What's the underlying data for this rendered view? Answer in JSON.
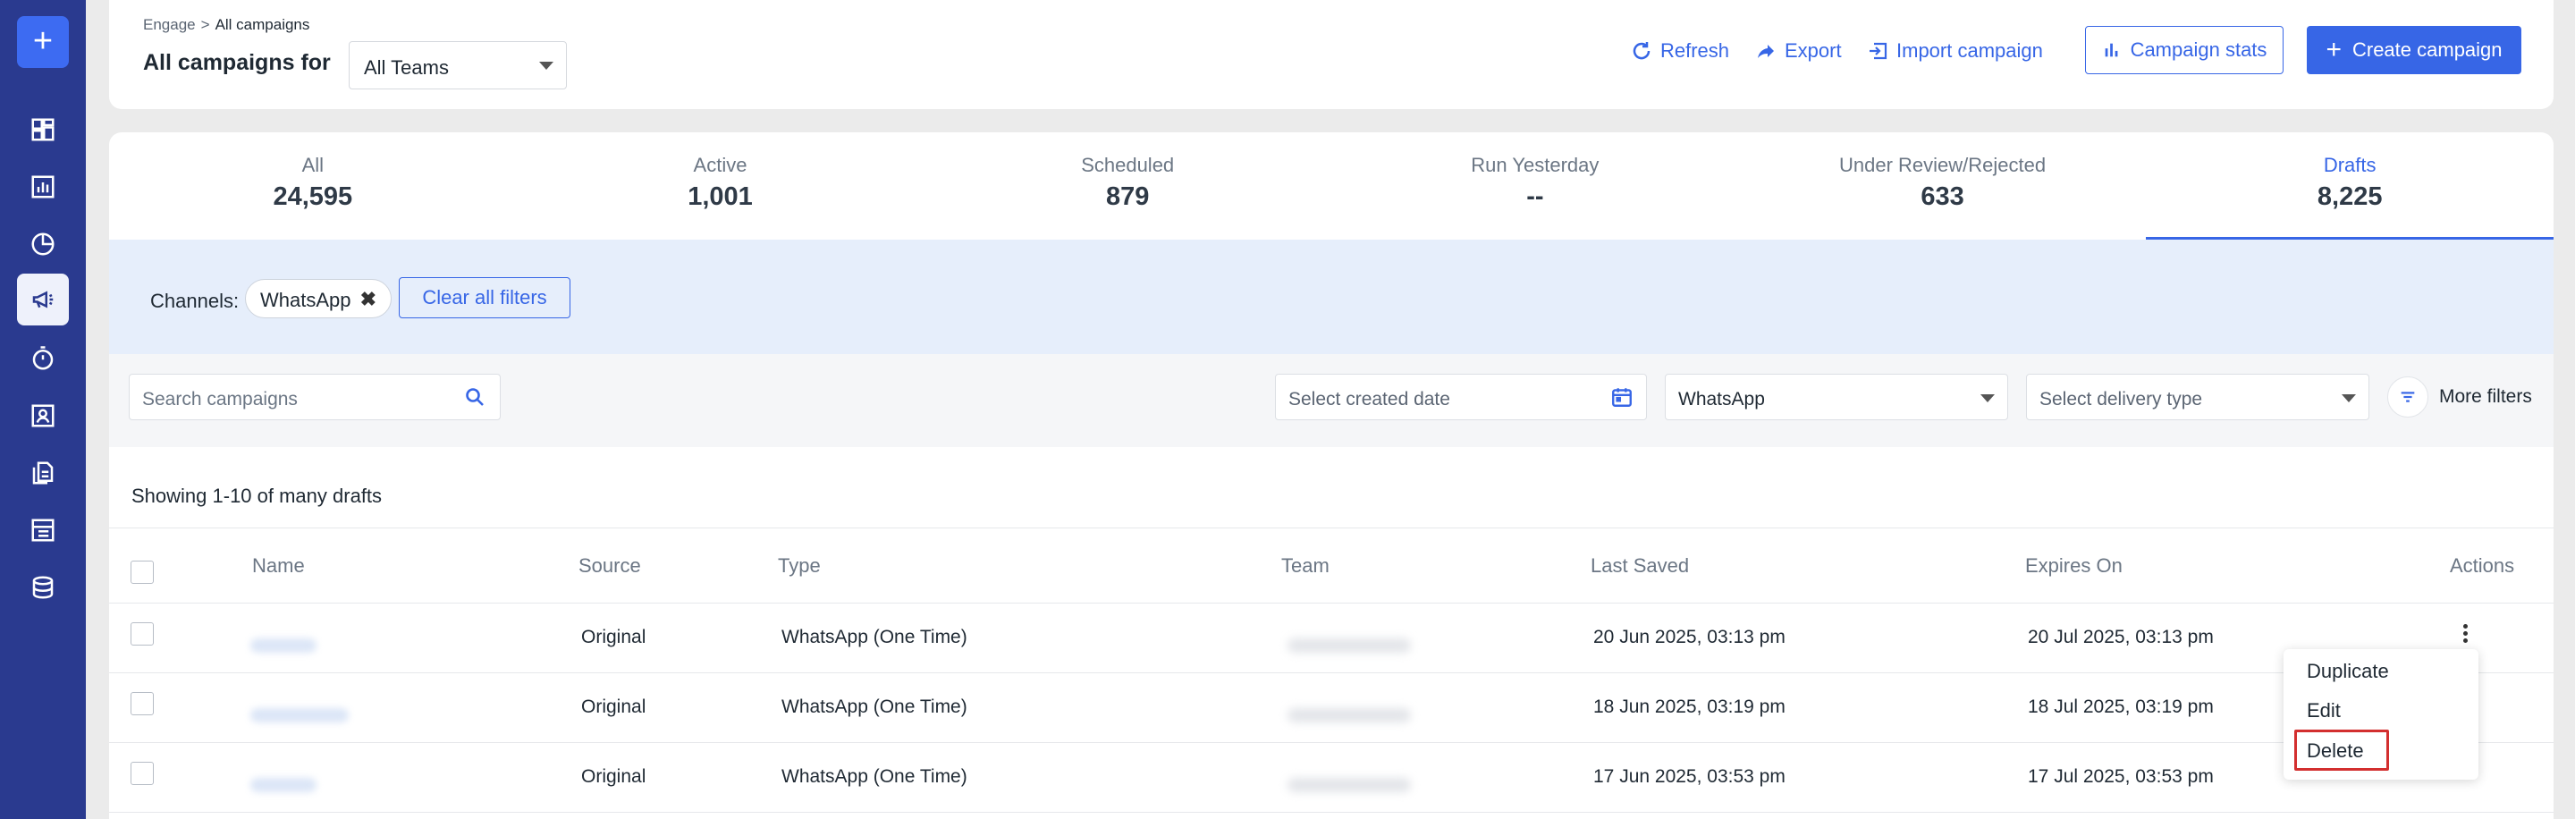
{
  "breadcrumb": {
    "parent": "Engage",
    "separator": ">",
    "current": "All campaigns"
  },
  "header": {
    "title": "All campaigns for",
    "team_select_value": "All Teams",
    "refresh_label": "Refresh",
    "export_label": "Export",
    "import_label": "Import campaign",
    "stats_label": "Campaign stats",
    "create_label": "Create campaign",
    "accent_color": "#3766e6"
  },
  "sidebar": {
    "icons": [
      "plus-icon",
      "dashboard-icon",
      "bar-chart-icon",
      "pie-chart-icon",
      "megaphone-icon",
      "timer-icon",
      "contact-icon",
      "documents-icon",
      "list-icon",
      "database-icon"
    ],
    "active": "megaphone-icon"
  },
  "stats": [
    {
      "label": "All",
      "value": "24,595"
    },
    {
      "label": "Active",
      "value": "1,001"
    },
    {
      "label": "Scheduled",
      "value": "879"
    },
    {
      "label": "Run Yesterday",
      "value": "--"
    },
    {
      "label": "Under Review/Rejected",
      "value": "633"
    },
    {
      "label": "Drafts",
      "value": "8,225"
    }
  ],
  "filters": {
    "channels_label": "Channels:",
    "chip_label": "WhatsApp",
    "clear_label": "Clear all filters"
  },
  "toolbar": {
    "search_placeholder": "Search campaigns",
    "date_placeholder": "Select created date",
    "channel_value": "WhatsApp",
    "delivery_placeholder": "Select delivery type",
    "more_filters_label": "More filters"
  },
  "table": {
    "showing": "Showing 1-10 of many drafts",
    "columns": [
      "Name",
      "Source",
      "Type",
      "Team",
      "Last Saved",
      "Expires On",
      "Actions"
    ],
    "rows": [
      {
        "source": "Original",
        "type": "WhatsApp (One Time)",
        "last_saved": "20 Jun 2025, 03:13 pm",
        "expires_on": "20 Jul 2025, 03:13 pm"
      },
      {
        "source": "Original",
        "type": "WhatsApp (One Time)",
        "last_saved": "18 Jun 2025, 03:19 pm",
        "expires_on": "18 Jul 2025, 03:19 pm"
      },
      {
        "source": "Original",
        "type": "WhatsApp (One Time)",
        "last_saved": "17 Jun 2025, 03:53 pm",
        "expires_on": "17 Jul 2025, 03:53 pm"
      }
    ]
  },
  "action_menu": {
    "items": [
      "Duplicate",
      "Edit",
      "Delete"
    ],
    "highlighted": "Delete",
    "highlight_color": "#d32f2f"
  }
}
